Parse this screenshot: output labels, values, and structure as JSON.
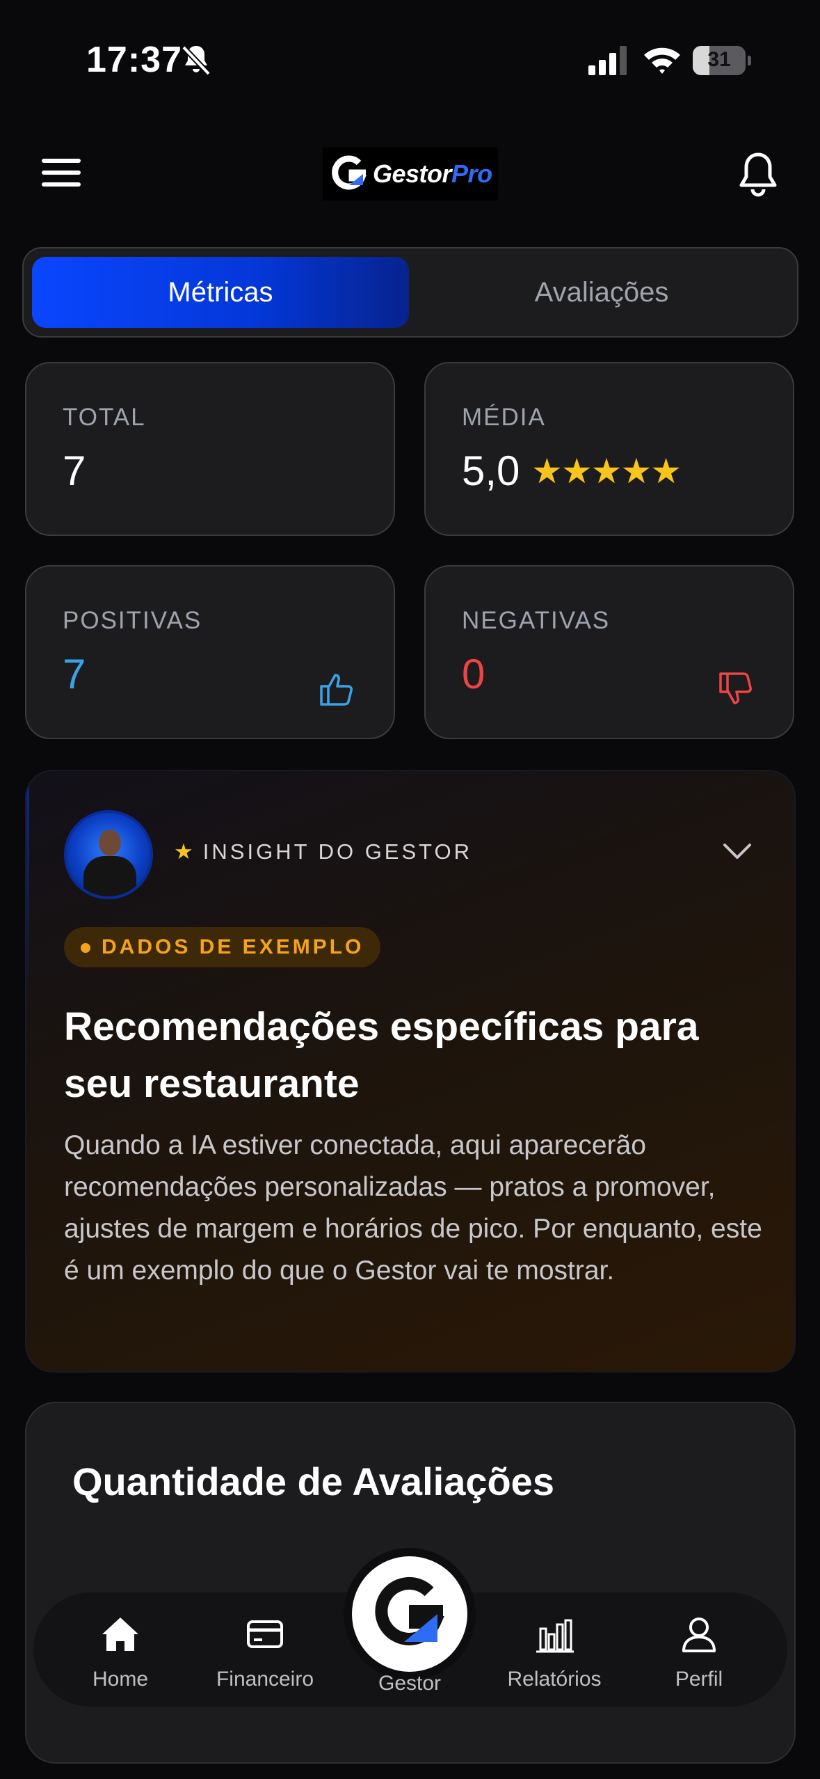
{
  "status_bar": {
    "time": "17:37",
    "battery": "31",
    "battery_level": 0.31
  },
  "header": {
    "logo_main": "Gestor",
    "logo_accent": "Pro"
  },
  "tabs": [
    {
      "label": "Métricas",
      "active": true
    },
    {
      "label": "Avaliações",
      "active": false
    }
  ],
  "metrics": {
    "total": {
      "label": "TOTAL",
      "value": "7"
    },
    "media": {
      "label": "MÉDIA",
      "value": "5,0",
      "stars": "★★★★★",
      "rating": 5
    },
    "positivas": {
      "label": "POSITIVAS",
      "value": "7"
    },
    "negativas": {
      "label": "NEGATIVAS",
      "value": "0"
    }
  },
  "insight": {
    "tag": "INSIGHT DO GESTOR",
    "badge": "DADOS DE EXEMPLO",
    "title": "Recomendações específicas para seu restaurante",
    "body": "Quando a IA estiver conectada, aqui aparecerão recomendações personalizadas — pratos a promover, ajustes de margem e horários de pico. Por enquanto, este é um exemplo do que o Gestor vai te mostrar."
  },
  "reviews_quantity": {
    "title": "Quantidade de Avaliações"
  },
  "nav": {
    "home": "Home",
    "financeiro": "Financeiro",
    "gestor": "Gestor",
    "relatorios": "Relatórios",
    "perfil": "Perfil"
  },
  "colors": {
    "accent_blue": "#0a46ff",
    "positive": "#3aa3e8",
    "negative": "#ef4444",
    "star": "#f8c51c",
    "badge": "#f5a31b"
  }
}
